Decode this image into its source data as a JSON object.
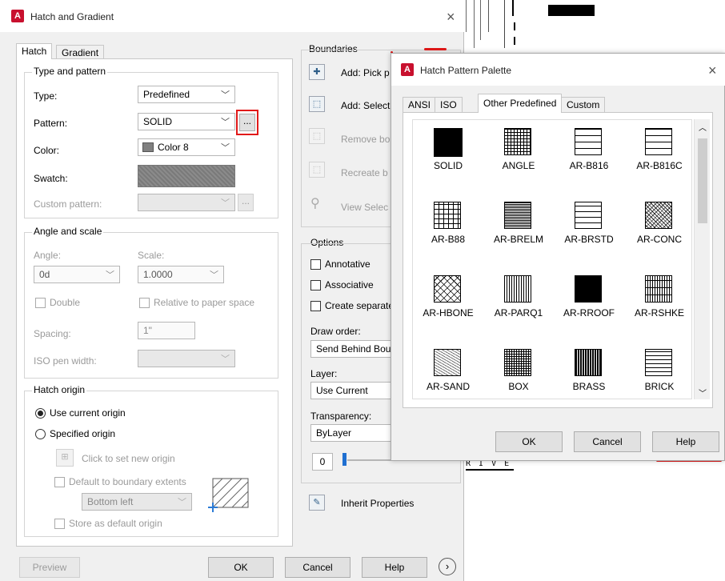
{
  "main_dialog": {
    "title": "Hatch and Gradient",
    "tabs": [
      "Hatch",
      "Gradient"
    ],
    "type_pattern": {
      "group_label": "Type and pattern",
      "type_label": "Type:",
      "type_value": "Predefined",
      "pattern_label": "Pattern:",
      "pattern_value": "SOLID",
      "browse_label": "...",
      "color_label": "Color:",
      "color_value": "Color 8",
      "swatch_label": "Swatch:",
      "custom_pattern_label": "Custom pattern:",
      "custom_browse_label": "..."
    },
    "angle_scale": {
      "group_label": "Angle and scale",
      "angle_label": "Angle:",
      "angle_value": "0d",
      "scale_label": "Scale:",
      "scale_value": "1.0000",
      "double_label": "Double",
      "relative_label": "Relative to paper space",
      "spacing_label": "Spacing:",
      "spacing_value": "1\"",
      "iso_label": "ISO pen width:"
    },
    "origin": {
      "group_label": "Hatch origin",
      "use_current": "Use current origin",
      "specified": "Specified origin",
      "click_set": "Click to set new origin",
      "default_extents": "Default to boundary extents",
      "position_value": "Bottom left",
      "store_default": "Store as default origin"
    },
    "boundaries": {
      "group_label": "Boundaries",
      "add_pick": "Add: Pick p",
      "add_select": "Add: Select",
      "remove": "Remove bo",
      "recreate": "Recreate b",
      "view": "View Selec"
    },
    "options": {
      "group_label": "Options",
      "annotative": "Annotative",
      "associative": "Associative",
      "create_separate": "Create separate",
      "draw_order_label": "Draw order:",
      "draw_order_value": "Send Behind Bou",
      "layer_label": "Layer:",
      "layer_value": "Use Current",
      "transparency_label": "Transparency:",
      "transparency_value": "ByLayer",
      "transparency_number": "0"
    },
    "inherit": "Inherit Properties",
    "buttons": {
      "preview": "Preview",
      "ok": "OK",
      "cancel": "Cancel",
      "help": "Help"
    }
  },
  "palette": {
    "title": "Hatch Pattern Palette",
    "tabs": [
      "ANSI",
      "ISO",
      "Other Predefined",
      "Custom"
    ],
    "active_tab": "Other Predefined",
    "patterns": [
      "SOLID",
      "ANGLE",
      "AR-B816",
      "AR-B816C",
      "AR-B88",
      "AR-BRELM",
      "AR-BRSTD",
      "AR-CONC",
      "AR-HBONE",
      "AR-PARQ1",
      "AR-RROOF",
      "AR-RSHKE",
      "AR-SAND",
      "BOX",
      "BRASS",
      "BRICK"
    ],
    "buttons": {
      "ok": "OK",
      "cancel": "Cancel",
      "help": "Help"
    }
  },
  "background": {
    "partial_text": "R I V E"
  },
  "colors": {
    "annotation_red": "#e11919",
    "autocad_red": "#c8102e"
  }
}
